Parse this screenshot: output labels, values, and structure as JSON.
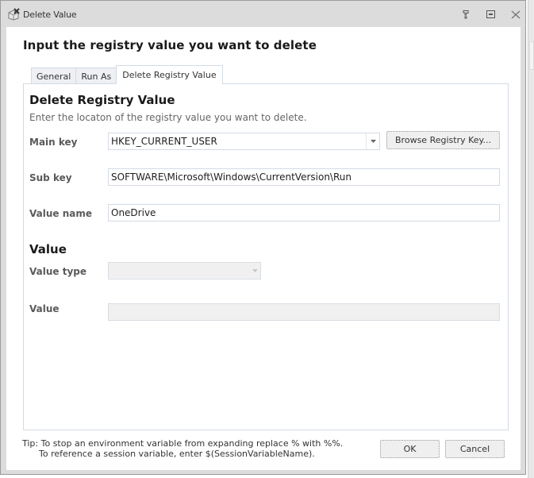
{
  "window": {
    "title": "Delete Value",
    "icon": "registry-delete-icon",
    "controls": [
      "help-icon",
      "maximize-icon",
      "close-icon"
    ]
  },
  "heading": "Input the registry value you want to delete",
  "tabs": [
    {
      "label": "General",
      "active": false
    },
    {
      "label": "Run As",
      "active": false
    },
    {
      "label": "Delete Registry Value",
      "active": true
    }
  ],
  "panel": {
    "section_title": "Delete Registry Value",
    "description": "Enter the locaton of the registry value you want to delete.",
    "main_key": {
      "label": "Main key",
      "value": "HKEY_CURRENT_USER"
    },
    "browse_button": "Browse Registry Key...",
    "sub_key": {
      "label": "Sub key",
      "value": "SOFTWARE\\Microsoft\\Windows\\CurrentVersion\\Run"
    },
    "value_name": {
      "label": "Value name",
      "value": "OneDrive"
    },
    "value_section_title": "Value",
    "value_type": {
      "label": "Value type",
      "value": "",
      "disabled": true
    },
    "value": {
      "label": "Value",
      "value": "",
      "disabled": true
    }
  },
  "tip": {
    "line1": "Tip: To stop an environment variable from expanding replace % with %%.",
    "line2": "To reference a session variable, enter $(SessionVariableName)."
  },
  "buttons": {
    "ok": "OK",
    "cancel": "Cancel"
  }
}
